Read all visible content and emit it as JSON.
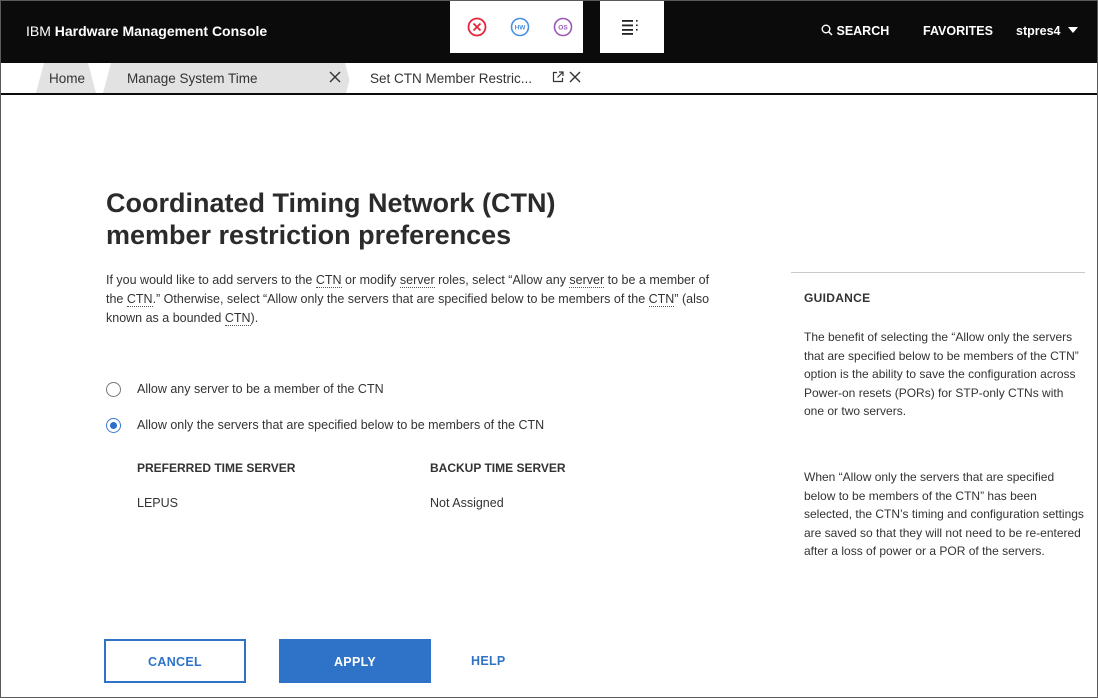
{
  "header": {
    "brand_prefix": "IBM",
    "brand_name": "Hardware Management Console",
    "search_label": "SEARCH",
    "favorites_label": "FAVORITES",
    "user_name": "stpres4",
    "hw_icon_text": "HW",
    "os_icon_text": "OS",
    "colors": {
      "error": "#e6243a",
      "hw": "#4a90e2",
      "os": "#9b59b6",
      "bar": "#0b0b0b"
    }
  },
  "tabs": [
    {
      "label": "Home"
    },
    {
      "label": "Manage System Time"
    },
    {
      "label": "Set CTN Member Restric..."
    }
  ],
  "main": {
    "title": "Coordinated Timing Network (CTN) member restriction preferences",
    "intro": {
      "p1": "If you would like to add servers to the ",
      "ctn1": "CTN",
      "p2": " or modify ",
      "server1": "server",
      "p3": " roles, select “Allow any ",
      "server2": "server",
      "p4": " to be a member of the ",
      "ctn2": "CTN",
      "p5": ".” Otherwise, select “Allow only the servers that are specified below to be members of the ",
      "ctn3": "CTN",
      "p6": "” (also known as a bounded ",
      "ctn4": "CTN",
      "p7": ")."
    },
    "options": [
      {
        "label": "Allow any server to be a member of the CTN",
        "selected": false
      },
      {
        "label": "Allow only the servers that are specified below to be members of the CTN",
        "selected": true
      }
    ],
    "servers": {
      "preferred_header": "PREFERRED TIME SERVER",
      "backup_header": "BACKUP TIME SERVER",
      "preferred_value": "LEPUS",
      "backup_value": "Not Assigned"
    }
  },
  "guidance": {
    "title": "GUIDANCE",
    "p1": "The benefit of selecting the “Allow only the servers that are specified below to be members of the CTN” option is the ability to save the configuration across Power-on resets (PORs) for STP-only CTNs with one or two servers.",
    "p2": "When “Allow only the servers that are specified below to be members of the CTN” has been selected, the CTN’s timing and configuration settings are saved so that they will not need to be re-entered after a loss of power or a POR of the servers."
  },
  "actions": {
    "cancel": "CANCEL",
    "apply": "APPLY",
    "help": "HELP",
    "accent": "#2f73c8"
  }
}
